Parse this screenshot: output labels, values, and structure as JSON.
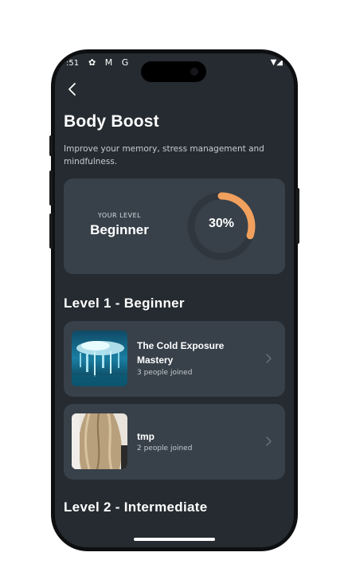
{
  "status_bar": {
    "time": ":51",
    "icons": [
      "gear-icon",
      "gmail-icon",
      "google-icon"
    ],
    "icon_glyphs": "✿ M G",
    "right_icons": [
      "wifi-icon",
      "signal-icon"
    ],
    "right_glyphs": "▼◢"
  },
  "header": {
    "title": "Body Boost",
    "description": "Improve your memory, stress management and mindfulness."
  },
  "level_card": {
    "caption": "YOUR LEVEL",
    "level": "Beginner",
    "progress_label": "30%",
    "progress_fraction": 0.3,
    "ring_color": "#f2a05e",
    "track_color": "#2f363d"
  },
  "sections": [
    {
      "title": "Level 1 - Beginner",
      "courses": [
        {
          "name": "The Cold Exposure Mastery",
          "joined": "3 people joined",
          "thumbnail": "ice-image"
        },
        {
          "name": "tmp",
          "joined": "2 people joined",
          "thumbnail": "hair-image"
        }
      ]
    },
    {
      "title": "Level 2 - Intermediate",
      "courses": []
    }
  ],
  "colors": {
    "background": "#252b30",
    "card": "#38414a",
    "accent": "#f2a05e"
  }
}
